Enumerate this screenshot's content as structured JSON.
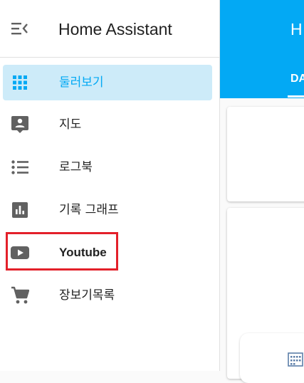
{
  "sidebar": {
    "title": "Home Assistant",
    "items": [
      {
        "label": "둘러보기",
        "icon": "dashboard-grid-icon",
        "active": true
      },
      {
        "label": "지도",
        "icon": "account-box-map-icon"
      },
      {
        "label": "로그북",
        "icon": "format-list-bulleted-icon"
      },
      {
        "label": "기록 그래프",
        "icon": "chart-box-icon"
      },
      {
        "label": "Youtube",
        "icon": "youtube-icon"
      },
      {
        "label": "장보기목록",
        "icon": "cart-icon"
      }
    ]
  },
  "main": {
    "title": "H",
    "tab": "DA"
  },
  "colors": {
    "primary": "#03a9f4",
    "active_bg": "#cdebf9",
    "highlight": "#e3202a",
    "icon": "#616161"
  }
}
